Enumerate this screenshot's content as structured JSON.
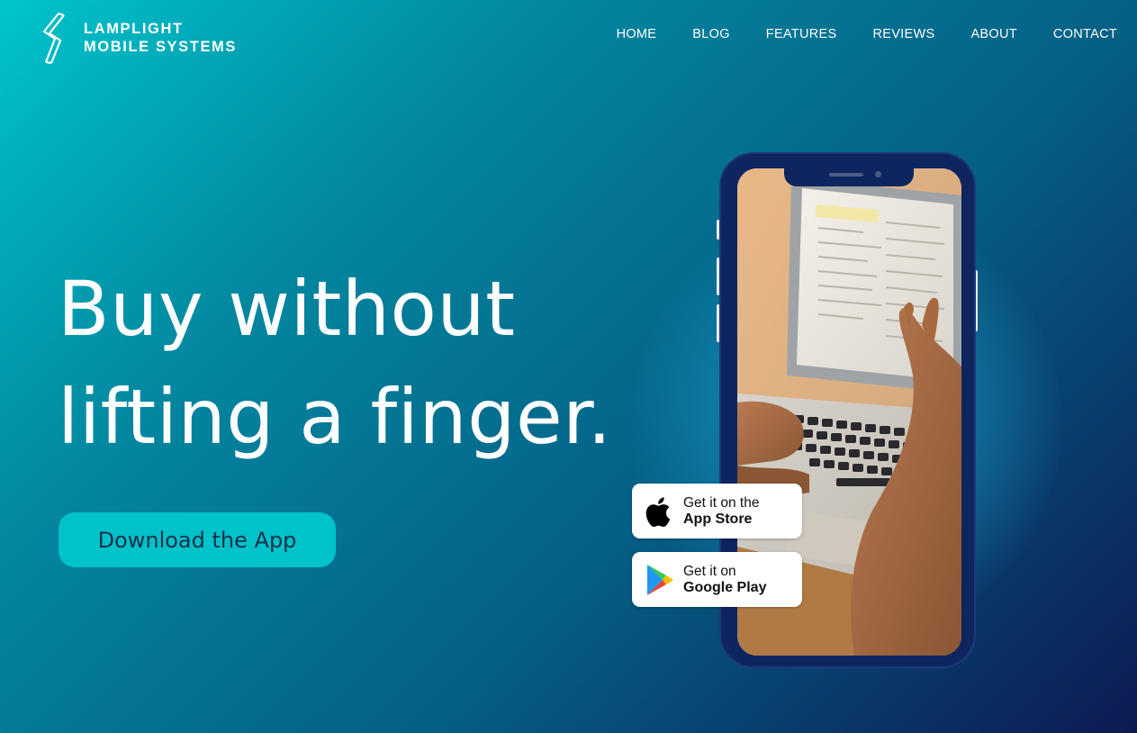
{
  "brand": {
    "line1": "LAMPLIGHT",
    "line2": "MOBILE SYSTEMS"
  },
  "nav": {
    "items": [
      "HOME",
      "BLOG",
      "FEATURES",
      "REVIEWS",
      "ABOUT",
      "CONTACT"
    ]
  },
  "hero": {
    "headline_line1": "Buy without",
    "headline_line2": "lifting a finger.",
    "cta_label": "Download the App"
  },
  "badges": {
    "app_store": {
      "small": "Get it on the",
      "big": "App Store",
      "icon": "apple-icon"
    },
    "google_play": {
      "small": "Get it on",
      "big": "Google Play",
      "icon": "google-play-icon"
    }
  },
  "colors": {
    "accent": "#00c2c9",
    "gradient_start": "#00c4cc",
    "gradient_end": "#0d1a52",
    "phone_frame": "#0f2560"
  }
}
